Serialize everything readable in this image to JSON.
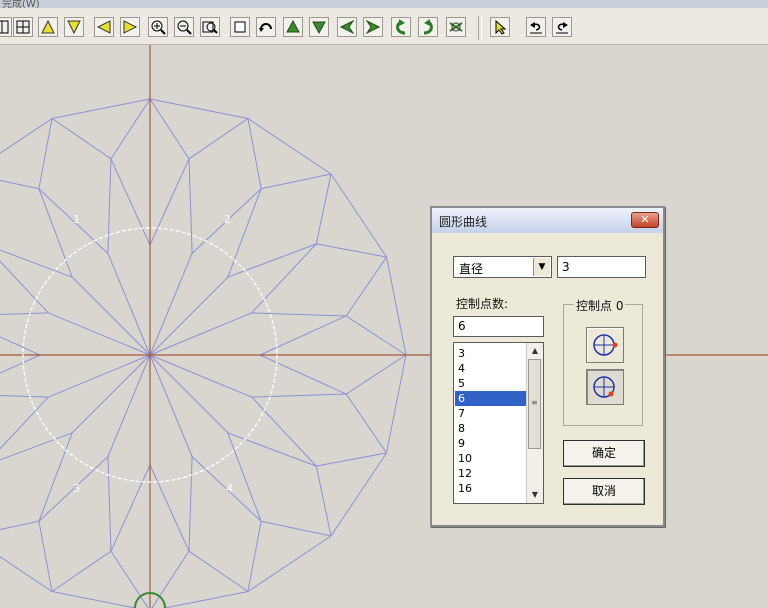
{
  "window": {
    "title_fragment": "完成(W)"
  },
  "toolbar": {
    "icons": [
      "grid-small-icon",
      "grid-icon",
      "triangle-up-icon",
      "triangle-down-icon",
      "triangle-left-icon",
      "triangle-right-icon",
      "zoom-in-icon",
      "zoom-out-icon",
      "zoom-window-icon",
      "rectangle-icon",
      "rotate-view-icon",
      "arrow-up-icon",
      "arrow-down-icon",
      "arrow-left-icon",
      "arrow-right-icon",
      "rotate-left-icon",
      "rotate-right-icon",
      "redraw-icon",
      "pointer-icon",
      "undo-icon",
      "redo-icon"
    ]
  },
  "canvas": {
    "colors": {
      "background": "#d9d6cf",
      "axes": "#a65a3a",
      "mesh": "#8d8fd8",
      "circle": "#ffffff"
    },
    "markers": [
      "1",
      "2",
      "3",
      "4"
    ]
  },
  "dialog": {
    "title": "圆形曲线",
    "close": "✕",
    "mode_select": {
      "value": "直径",
      "arrow": "▼"
    },
    "diameter_value": "3",
    "control_points_label": "控制点数:",
    "control_points_value": "6",
    "list": {
      "items": [
        "3",
        "4",
        "5",
        "6",
        "7",
        "8",
        "9",
        "10",
        "12",
        "16"
      ],
      "selected": "6",
      "scroll_grip": "≡"
    },
    "control_point_group": {
      "title": "控制点 0"
    },
    "ok_label": "确定",
    "cancel_label": "取消"
  }
}
